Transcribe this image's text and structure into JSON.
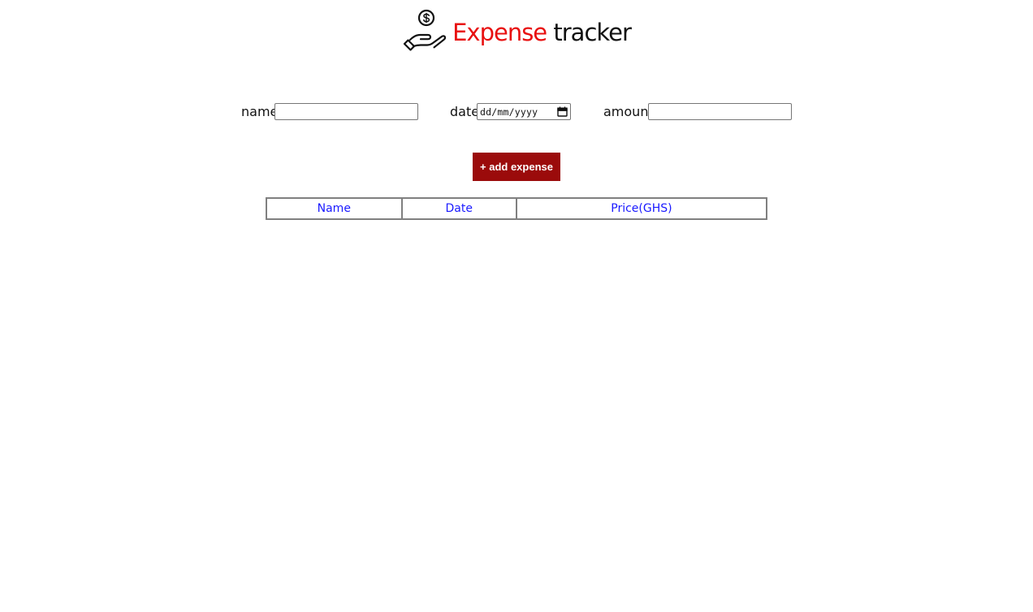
{
  "header": {
    "logo_icon": "hand-holding-coin-icon",
    "title_accent": "Expense",
    "title_rest": " tracker",
    "accent_color": "#e81010"
  },
  "form": {
    "name_label": "name",
    "name_value": "",
    "date_label": "date",
    "date_placeholder": "dd/mm/yyyy",
    "date_icon": "calendar-icon",
    "amount_label": "amount",
    "amount_value": ""
  },
  "add_button": {
    "label": "+ add expense",
    "color": "#9b0b0b"
  },
  "table": {
    "columns": [
      "Name",
      "Date",
      "Price(GHS)"
    ],
    "header_color": "#1a1aff",
    "rows": []
  }
}
